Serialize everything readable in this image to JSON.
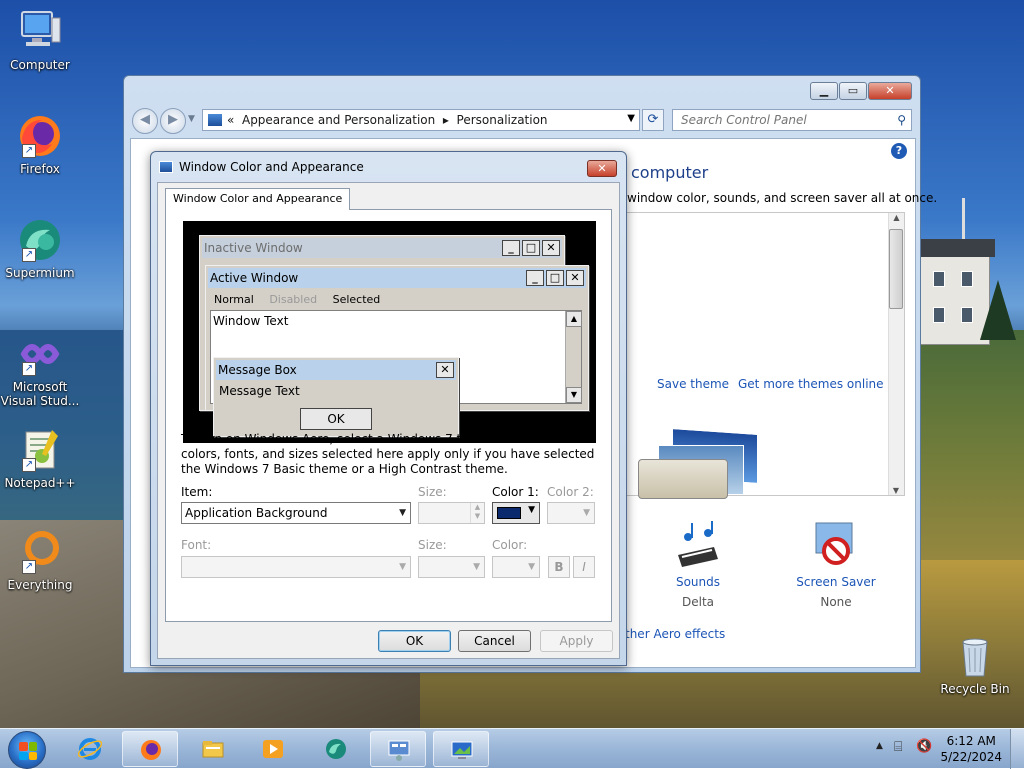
{
  "desktop": {
    "icons": [
      {
        "label": "Computer",
        "icon": "computer-icon"
      },
      {
        "label": "Firefox",
        "icon": "firefox-icon"
      },
      {
        "label": "Supermium",
        "icon": "supermium-icon"
      },
      {
        "label": "Microsoft Visual Stud...",
        "icon": "visual-studio-icon"
      },
      {
        "label": "Notepad++",
        "icon": "notepadpp-icon"
      },
      {
        "label": "Everything",
        "icon": "everything-icon"
      },
      {
        "label": "Recycle Bin",
        "icon": "recycle-bin-icon"
      }
    ]
  },
  "control_panel": {
    "address_sep": "«",
    "breadcrumb": [
      "Appearance and Personalization",
      "Personalization"
    ],
    "breadcrumb_sep": "▸",
    "search_placeholder": "Search Control Panel",
    "help": "?",
    "title": "computer",
    "description": "window color, sounds, and screen saver all at once.",
    "save_theme": "Save theme",
    "get_more_themes": "Get more themes online",
    "sounds_label": "Sounds",
    "sounds_value": "Delta",
    "screensaver_label": "Screen Saver",
    "screensaver_value": "None",
    "aero_link": "ther Aero effects"
  },
  "dialog": {
    "title": "Window Color and Appearance",
    "close": "✕",
    "tab": "Window Color and Appearance",
    "preview": {
      "inactive_title": "Inactive Window",
      "active_title": "Active Window",
      "menu_normal": "Normal",
      "menu_disabled": "Disabled",
      "menu_selected": "Selected",
      "window_text": "Window Text",
      "msgbox_title": "Message Box",
      "msgbox_text": "Message Text",
      "msgbox_ok": "OK"
    },
    "info": "To turn on Windows Aero, select a Windows 7 theme.  Some of the colors, fonts, and sizes selected here apply only if you have selected the Windows 7 Basic theme or a High Contrast theme.",
    "item_label": "Item:",
    "item_value": "Application Background",
    "size_label": "Size:",
    "color1_label": "Color 1:",
    "color1_value": "#0b2a6e",
    "color2_label": "Color 2:",
    "font_label": "Font:",
    "font_size_label": "Size:",
    "font_color_label": "Color:",
    "bold": "B",
    "italic": "I",
    "ok": "OK",
    "cancel": "Cancel",
    "apply": "Apply"
  },
  "taskbar": {
    "items": [
      {
        "icon": "internet-explorer-icon"
      },
      {
        "icon": "firefox-icon"
      },
      {
        "icon": "file-explorer-icon"
      },
      {
        "icon": "media-player-icon"
      },
      {
        "icon": "supermium-icon"
      },
      {
        "icon": "control-panel-icon"
      },
      {
        "icon": "personalization-icon"
      }
    ],
    "time": "6:12 AM",
    "date": "5/22/2024"
  }
}
